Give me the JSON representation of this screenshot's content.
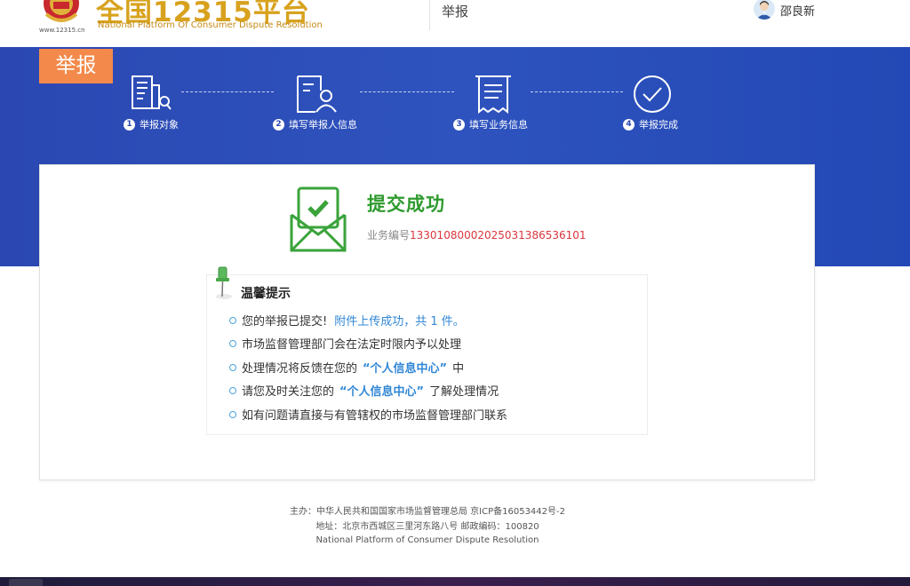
{
  "header": {
    "logo_url": "www.12315.cn",
    "logo_title": "全国12315平台",
    "logo_subtitle": "National Platform Of Consumer Dispute Resolution",
    "nav_label": "举报",
    "username": "邵良新"
  },
  "banner": {
    "tag": "举报",
    "steps": [
      {
        "num": "1",
        "label": "举报对象",
        "icon": "document-search-icon"
      },
      {
        "num": "2",
        "label": "填写举报人信息",
        "icon": "user-form-icon"
      },
      {
        "num": "3",
        "label": "填写业务信息",
        "icon": "receipt-icon"
      },
      {
        "num": "4",
        "label": "举报完成",
        "icon": "check-circle-icon"
      }
    ]
  },
  "result": {
    "title": "提交成功",
    "biz_label": "业务编号",
    "biz_no": "13301080002025031386536101"
  },
  "tips": {
    "title": "温馨提示",
    "items": [
      {
        "text": "您的举报已提交!",
        "highlight": "附件上传成功，共 1 件。",
        "tail": ""
      },
      {
        "text": "市场监督管理部门会在法定时限内予以处理",
        "highlight": "",
        "tail": ""
      },
      {
        "text": "处理情况将反馈在您的",
        "highlight": "“个人信息中心”",
        "tail": "中"
      },
      {
        "text": "请您及时关注您的",
        "highlight": "“个人信息中心”",
        "tail": "了解处理情况"
      },
      {
        "text": "如有问题请直接与有管辖权的市场监督管理部门联系",
        "highlight": "",
        "tail": ""
      }
    ]
  },
  "footer": {
    "line1": "主办：中华人民共和国国家市场监督管理总局 京ICP备16053442号-2",
    "line2": "地址：北京市西城区三里河东路八号 邮政编码：100820",
    "line3": "National Platform of Consumer Dispute Resolution"
  },
  "colors": {
    "banner": "#2b48b2",
    "tag": "#f3894a",
    "success": "#2e9a2e",
    "biz_no": "#d9363e",
    "highlight": "#3187d6",
    "logo_gold": "#d8a21e"
  }
}
